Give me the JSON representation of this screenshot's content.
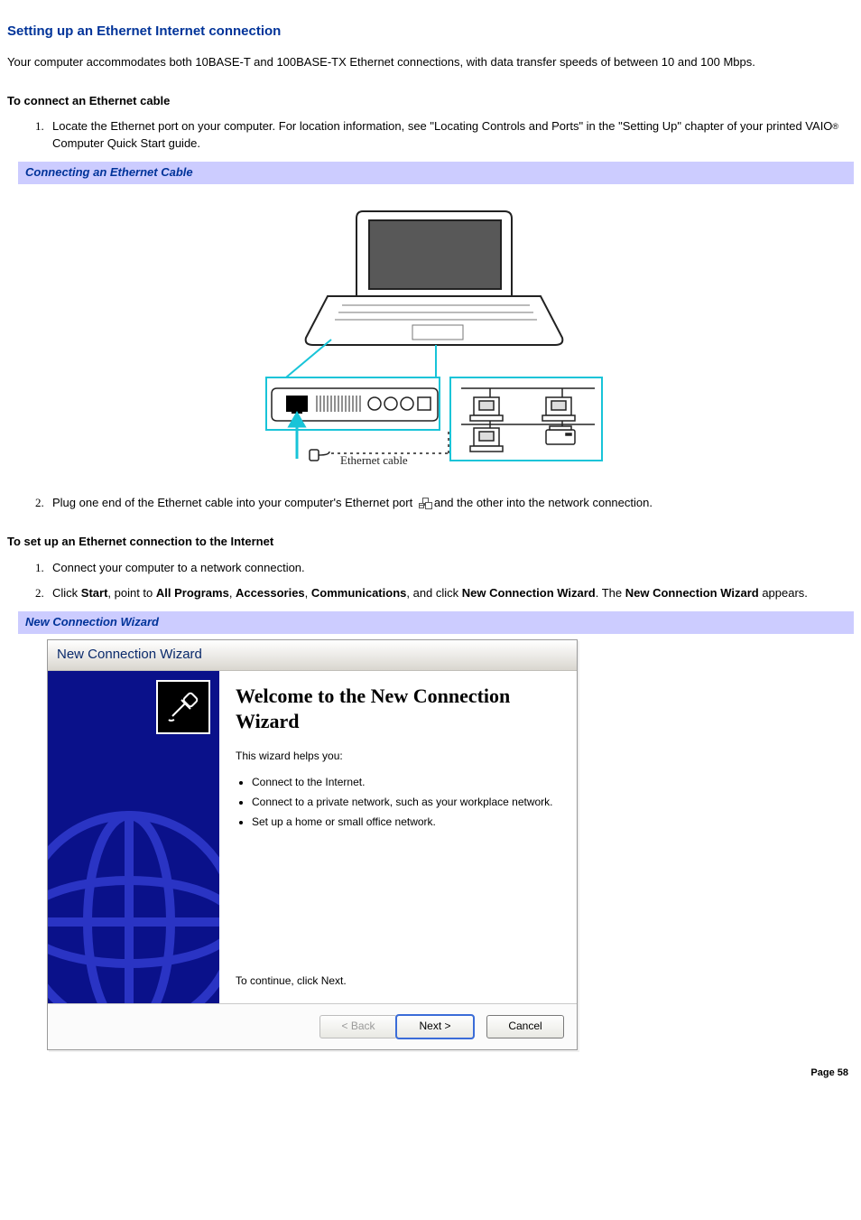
{
  "page": {
    "title": "Setting up an Ethernet Internet connection",
    "intro": "Your computer accommodates both 10BASE-T and 100BASE-TX Ethernet connections, with data transfer speeds of between 10 and 100 Mbps.",
    "section1_heading": "To connect an Ethernet cable",
    "step1a_pre": "Locate the Ethernet port on your computer. For location information, see \"Locating Controls and Ports\" in the \"Setting Up\" chapter of your printed VAIO",
    "step1a_post": " Computer Quick Start guide.",
    "banner1": "Connecting an Ethernet Cable",
    "figure_label": "Ethernet cable",
    "step1b_pre": "Plug one end of the Ethernet cable into your computer's Ethernet port ",
    "step1b_post": "and the other into the network connection.",
    "section2_heading": "To set up an Ethernet connection to the Internet",
    "step2a": "Connect your computer to a network connection.",
    "step2b_parts": {
      "p0": "Click ",
      "p1": "Start",
      "p2": ", point to ",
      "p3": "All Programs",
      "p4": ", ",
      "p5": "Accessories",
      "p6": ", ",
      "p7": "Communications",
      "p8": ", and click ",
      "p9": "New Connection Wizard",
      "p10": ". The ",
      "p11": "New Connection Wizard",
      "p12": " appears."
    },
    "banner2": "New Connection Wizard",
    "page_number": "Page 58"
  },
  "wizard": {
    "title_bar": "New Connection Wizard",
    "heading": "Welcome to the New Connection Wizard",
    "lead": "This wizard helps you:",
    "bullets": [
      "Connect to the Internet.",
      "Connect to a private network, such as your workplace network.",
      "Set up a home or small office network."
    ],
    "continue": "To continue, click Next.",
    "buttons": {
      "back": "< Back",
      "next": "Next >",
      "cancel": "Cancel"
    }
  }
}
